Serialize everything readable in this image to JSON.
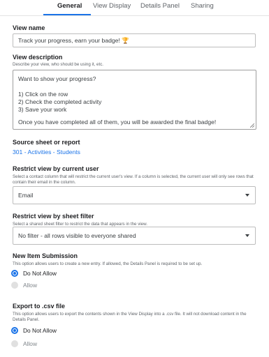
{
  "tabs": [
    {
      "label": "General",
      "active": true
    },
    {
      "label": "View Display",
      "active": false
    },
    {
      "label": "Details Panel",
      "active": false
    },
    {
      "label": "Sharing",
      "active": false
    }
  ],
  "view_name": {
    "label": "View name",
    "value": "Track your progress, earn your badge! 🏆"
  },
  "view_description": {
    "label": "View description",
    "help": "Describe your view, who should be using it, etc.",
    "lines": [
      "Want to show your progress?",
      "",
      "1) Click on the row",
      "2) Check the completed activity",
      "3) Save your work",
      "",
      "Once you have completed all of them, you will be awarded the final badge!"
    ]
  },
  "source": {
    "label": "Source sheet or report",
    "link": "301 - Activities - Students"
  },
  "restrict_user": {
    "label": "Restrict view by current user",
    "help": "Select a contact column that will restrict the current user's view. If a column is selected, the current user will only see rows that contain their email in the column.",
    "value": "Email"
  },
  "restrict_filter": {
    "label": "Restrict view by sheet filter",
    "help": "Select a shared sheet filter to restrict the data that appears in the view.",
    "value": "No filter - all rows visible to everyone shared"
  },
  "new_item": {
    "label": "New Item Submission",
    "help": "This option allows users to create a new entry. If allowed, the Details Panel is required to be set up.",
    "options": [
      "Do Not Allow",
      "Allow"
    ],
    "selected": "Do Not Allow"
  },
  "export_csv": {
    "label": "Export to .csv file",
    "help": "This option allows users to export the contents shown in the View Display into a .csv file. It will not download content in the Details Panel.",
    "options": [
      "Do Not Allow",
      "Allow"
    ],
    "selected": "Do Not Allow"
  },
  "colors": {
    "accent": "#1a73e8",
    "text": "#202124",
    "muted": "#5f6368",
    "border": "#bdbdbd"
  },
  "icons": {
    "dropdown": "caret-down-icon",
    "resize": "resize-grip-icon"
  }
}
